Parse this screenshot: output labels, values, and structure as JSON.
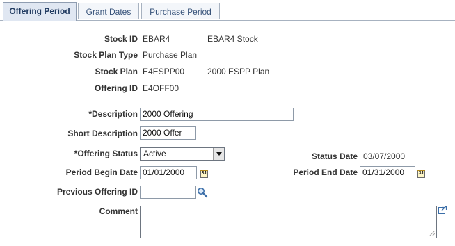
{
  "tabs": [
    {
      "label": "Offering Period",
      "active": true
    },
    {
      "label": "Grant Dates",
      "active": false
    },
    {
      "label": "Purchase Period",
      "active": false
    }
  ],
  "summary": {
    "stock_id_label": "Stock ID",
    "stock_id": "EBAR4",
    "stock_desc": "EBAR4 Stock",
    "stock_plan_type_label": "Stock Plan Type",
    "stock_plan_type": "Purchase Plan",
    "stock_plan_label": "Stock Plan",
    "stock_plan": "E4ESPP00",
    "stock_plan_desc": "2000 ESPP Plan",
    "offering_id_label": "Offering ID",
    "offering_id": "E4OFF00"
  },
  "form": {
    "description_label": "*Description",
    "description": "2000 Offering",
    "short_description_label": "Short Description",
    "short_description": "2000 Offer",
    "offering_status_label": "*Offering Status",
    "offering_status": "Active",
    "status_date_label": "Status Date",
    "status_date": "03/07/2000",
    "period_begin_label": "Period Begin Date",
    "period_begin": "01/01/2000",
    "period_end_label": "Period End Date",
    "period_end": "01/31/2000",
    "previous_offering_label": "Previous Offering ID",
    "previous_offering": "",
    "comment_label": "Comment",
    "comment": ""
  },
  "icons": {
    "calendar": "calendar-icon",
    "lookup": "lookup-icon",
    "expand": "expand-icon"
  },
  "colors": {
    "tab_active": "#e0e7f2",
    "tab_inactive": "#f3f6fa",
    "tab_text": "#37537a"
  }
}
